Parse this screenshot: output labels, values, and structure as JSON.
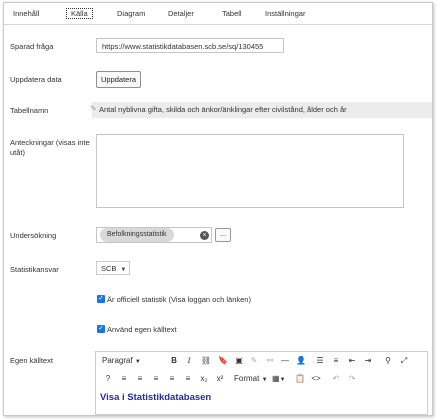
{
  "tabs": [
    "Innehåll",
    "Källa",
    "Diagram",
    "Detaljer",
    "Tabell",
    "Inställningar"
  ],
  "active_tab": "Källa",
  "saved_query": {
    "label": "Sparad fråga",
    "value": "https://www.statistikdatabasen.scb.se/sq/130455"
  },
  "update_data": {
    "label": "Uppdatera data",
    "button": "Uppdatera"
  },
  "table_name": {
    "label": "Tabellnamn",
    "value": "Antal nyblivna gifta, skilda och änkor/änklingar efter civilstånd, ålder och år"
  },
  "notes": {
    "label": "Anteckningar (visas inte utåt)",
    "value": ""
  },
  "survey": {
    "label": "Undersökning",
    "tag": "Befolkningsstatistik",
    "more_button": "..."
  },
  "responsible": {
    "label": "Statistikansvar",
    "value": "SCB"
  },
  "official": {
    "label": "Är officiell statistik (Visa loggan och länken)",
    "checked": true
  },
  "own_source": {
    "label": "Använd egen källtext",
    "checked": true
  },
  "source_editor": {
    "label": "Egen källtext",
    "paragraph": "Paragraf",
    "format": "Format",
    "content": "Visa i Statistikdatabasen"
  }
}
